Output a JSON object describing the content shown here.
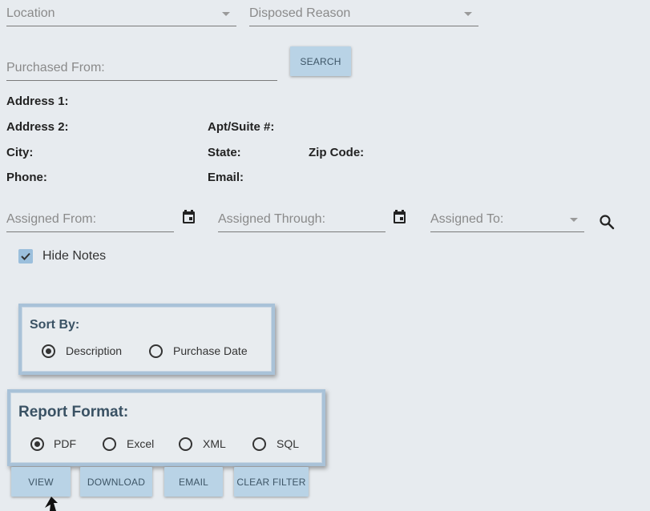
{
  "filters": {
    "location_placeholder": "Location",
    "disposed_reason_placeholder": "Disposed Reason",
    "purchased_from_placeholder": "Purchased From:",
    "search_button": "SEARCH"
  },
  "vendor_details": {
    "address1": "Address 1:",
    "address2": "Address 2:",
    "apt_suite": "Apt/Suite #:",
    "city": "City:",
    "state": "State:",
    "zip": "Zip Code:",
    "phone": "Phone:",
    "email": "Email:"
  },
  "assignment": {
    "assigned_from_placeholder": "Assigned From:",
    "assigned_through_placeholder": "Assigned Through:",
    "assigned_to_placeholder": "Assigned To:"
  },
  "hide_notes": {
    "label": "Hide Notes",
    "checked": true
  },
  "sort_by": {
    "title": "Sort By:",
    "options": [
      "Description",
      "Purchase Date"
    ],
    "selected": "Description"
  },
  "report_format": {
    "title": "Report Format:",
    "options": [
      "PDF",
      "Excel",
      "XML",
      "SQL"
    ],
    "selected": "PDF"
  },
  "actions": {
    "view": "VIEW",
    "download": "DOWNLOAD",
    "email": "EMAIL",
    "clear_filter": "CLEAR FILTER"
  },
  "colors": {
    "background": "#e7ebef",
    "button": "#b9d3e6",
    "panel_border": "#a9c2d8",
    "checkbox": "#9bbfdc"
  }
}
